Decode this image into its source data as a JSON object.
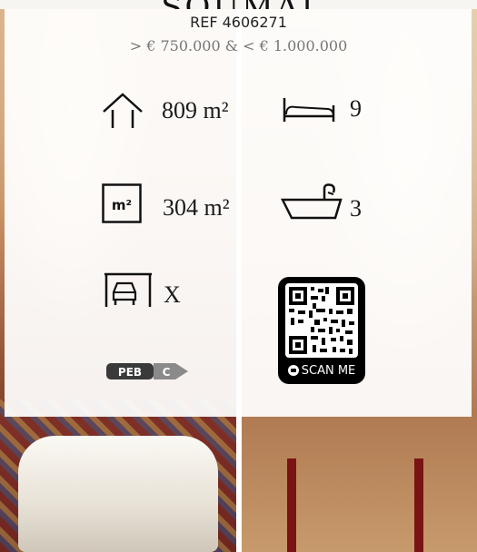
{
  "listing": {
    "heading_fragment": "SOUMAI",
    "ref": "REF 4606271",
    "price_range": "> € 750.000 & < € 1.000.000"
  },
  "stats": {
    "living_area": {
      "icon": "house-icon",
      "value": "809 m²"
    },
    "bedrooms": {
      "icon": "bed-icon",
      "value": "9"
    },
    "land_area": {
      "icon": "m2-area-icon",
      "value": "304 m²"
    },
    "bathrooms": {
      "icon": "bathtub-icon",
      "value": "3"
    },
    "garage": {
      "icon": "garage-icon",
      "value": "X"
    }
  },
  "peb": {
    "label": "PEB",
    "rating": "C"
  },
  "qr": {
    "label": "SCAN ME"
  },
  "colors": {
    "panel": "#ffffff",
    "text": "#1a1a1a",
    "price": "#777777",
    "peb_dark": "#3a3a3a",
    "peb_rating": "#8a8a8a"
  }
}
